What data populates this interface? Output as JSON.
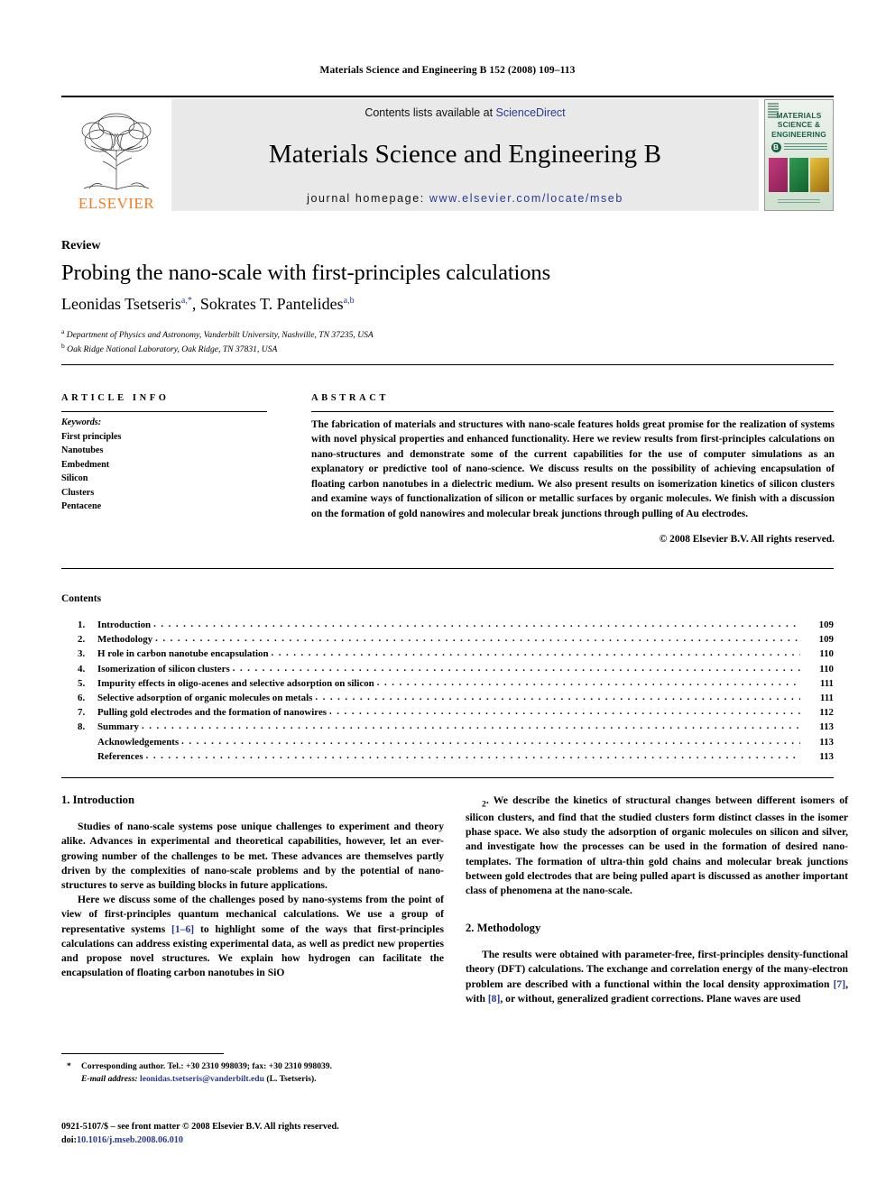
{
  "running_head": "Materials Science and Engineering B 152 (2008) 109–113",
  "header": {
    "publisher": "ELSEVIER",
    "contents_prefix": "Contents lists available at ",
    "contents_link": "ScienceDirect",
    "journal_title": "Materials Science and Engineering B",
    "homepage_prefix": "journal homepage: ",
    "homepage_url": "www.elsevier.com/locate/mseb",
    "cover": {
      "line1": "MATERIALS",
      "line2": "SCIENCE &",
      "line3": "ENGINEERING",
      "badge": "B",
      "swatch_colors": [
        "#b52a6e",
        "#1f7a3c",
        "#d8a81c"
      ]
    },
    "link_color": "#2B3990"
  },
  "article": {
    "type_label": "Review",
    "title": "Probing the nano-scale with first-principles calculations",
    "authors": [
      {
        "name": "Leonidas Tsetseris",
        "marks": "a,*"
      },
      {
        "name": "Sokrates T. Pantelides",
        "marks": "a,b"
      }
    ],
    "authors_line": "Leonidas Tsetseris",
    "affiliations": [
      {
        "mark": "a",
        "text": "Department of Physics and Astronomy, Vanderbilt University, Nashville, TN 37235, USA"
      },
      {
        "mark": "b",
        "text": "Oak Ridge National Laboratory, Oak Ridge, TN 37831, USA"
      }
    ]
  },
  "article_info": {
    "heading": "ARTICLE INFO",
    "keywords_label": "Keywords:",
    "keywords": [
      "First principles",
      "Nanotubes",
      "Embedment",
      "Silicon",
      "Clusters",
      "Pentacene"
    ]
  },
  "abstract": {
    "heading": "ABSTRACT",
    "text": "The fabrication of materials and structures with nano-scale features holds great promise for the realization of systems with novel physical properties and enhanced functionality. Here we review results from first-principles calculations on nano-structures and demonstrate some of the current capabilities for the use of computer simulations as an explanatory or predictive tool of nano-science. We discuss results on the possibility of achieving encapsulation of floating carbon nanotubes in a dielectric medium. We also present results on isomerization kinetics of silicon clusters and examine ways of functionalization of silicon or metallic surfaces by organic molecules. We finish with a discussion on the formation of gold nanowires and molecular break junctions through pulling of Au electrodes.",
    "copyright": "© 2008 Elsevier B.V. All rights reserved."
  },
  "contents": {
    "heading": "Contents",
    "entries": [
      {
        "num": "1.",
        "label": "Introduction",
        "page": "109"
      },
      {
        "num": "2.",
        "label": "Methodology",
        "page": "109"
      },
      {
        "num": "3.",
        "label": "H role in carbon nanotube encapsulation",
        "page": "110"
      },
      {
        "num": "4.",
        "label": "Isomerization of silicon clusters",
        "page": "110"
      },
      {
        "num": "5.",
        "label": "Impurity effects in oligo-acenes and selective adsorption on silicon",
        "page": "111"
      },
      {
        "num": "6.",
        "label": "Selective adsorption of organic molecules on metals",
        "page": "111"
      },
      {
        "num": "7.",
        "label": "Pulling gold electrodes and the formation of nanowires",
        "page": "112"
      },
      {
        "num": "8.",
        "label": "Summary",
        "page": "113"
      },
      {
        "num": "",
        "label": "Acknowledgements",
        "page": "113"
      },
      {
        "num": "",
        "label": "References",
        "page": "113"
      }
    ],
    "dots": ". . . . . . . . . . . . . . . . . . . . . . . . . . . . . . . . . . . . . . . . . . . . . . . . . . . . . . . . . . . . . . . . . . . . . . . . . . . . . . . . . . . . . . . . . . . . . . . . . . . . . . . . . . . . . . . . . . . . . . . . . . . . . . . . . . . . . . . . . . . . . . . . . . . . . . ."
  },
  "body": {
    "section1_heading": "1.  Introduction",
    "section1_p1": "Studies of nano-scale systems pose unique challenges to experiment and theory alike. Advances in experimental and theoretical capabilities, however, let an ever-growing number of the challenges to be met. These advances are themselves partly driven by the complexities of nano-scale problems and by the potential of nano-structures to serve as building blocks in future applications.",
    "section1_p2_a": "Here we discuss some of the challenges posed by nano-systems from the point of view of first-principles quantum mechanical calculations. We use a group of representative systems ",
    "section1_ref1": "[1–6]",
    "section1_p2_b": " to highlight some of the ways that first-principles calculations can address existing experimental data, as well as predict new properties and propose novel structures. We explain how hydrogen can facilitate the encapsulation of floating carbon nanotubes in SiO",
    "sio2_sub": "2",
    "section1_p2_c": ". We describe the kinetics of structural changes between different isomers of silicon clusters, and find that the studied clusters form distinct classes in the isomer phase space. We also study the adsorption of organic molecules on silicon and silver, and investigate how the processes can be used in the formation of desired nano-templates. The formation of ultra-thin gold chains and molecular break junctions between gold electrodes that are being pulled apart is discussed as another important class of phenomena at the nano-scale.",
    "section2_heading": "2.  Methodology",
    "section2_p1_a": "The results were obtained with parameter-free, first-principles density-functional theory (DFT) calculations. The exchange and correlation energy of the many-electron problem are described with a functional within the local density approximation ",
    "section2_ref7": "[7]",
    "section2_p1_b": ", with ",
    "section2_ref8": "[8]",
    "section2_p1_c": ", or without, generalized gradient corrections. Plane waves are used"
  },
  "footnotes": {
    "star": "*",
    "corresponding": "Corresponding author. Tel.: +30 2310 998039; fax: +30 2310 998039.",
    "email_label": "E-mail address:",
    "email": "leonidas.tsetseris@vanderbilt.edu",
    "email_owner": "(L. Tsetseris).",
    "issn_line": "0921-5107/$ – see front matter © 2008 Elsevier B.V. All rights reserved.",
    "doi_label": "doi:",
    "doi": "10.1016/j.mseb.2008.06.010"
  }
}
